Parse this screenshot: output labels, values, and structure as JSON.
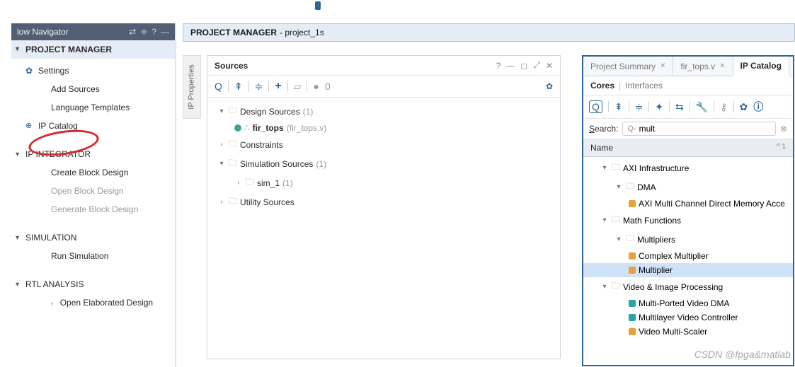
{
  "flow_nav": {
    "title": "low Navigator",
    "section0": {
      "label": "PROJECT MANAGER"
    },
    "items0": {
      "settings": "Settings",
      "add_sources": "Add Sources",
      "lang_tmpl": "Language Templates",
      "ip_catalog": "IP Catalog"
    },
    "section1": {
      "label": "IP INTEGRATOR"
    },
    "items1": {
      "create_bd": "Create Block Design",
      "open_bd": "Open Block Design",
      "gen_bd": "Generate Block Design"
    },
    "section2": {
      "label": "SIMULATION"
    },
    "items2": {
      "run_sim": "Run Simulation"
    },
    "section3": {
      "label": "RTL ANALYSIS"
    },
    "items3": {
      "open_elab": "Open Elaborated Design"
    }
  },
  "proj_header": {
    "prefix": "PROJECT MANAGER",
    "name": "- project_1s"
  },
  "ip_props_tab": "IP Properties",
  "sources": {
    "title": "Sources",
    "help": "?",
    "count": "0",
    "tree": {
      "design_sources": "Design Sources",
      "design_sources_cnt": "(1)",
      "fir_tops": "fir_tops",
      "fir_tops_file": "(fir_tops.v)",
      "constraints": "Constraints",
      "sim_sources": "Simulation Sources",
      "sim_sources_cnt": "(1)",
      "sim_1": "sim_1",
      "sim_1_cnt": "(1)",
      "utility": "Utility Sources"
    }
  },
  "right": {
    "tab_summary": "Project Summary",
    "tab_fir": "fir_tops.v",
    "tab_catalog": "IP Catalog",
    "subtab_cores": "Cores",
    "subtab_ifaces": "Interfaces",
    "search_label": "Search:",
    "search_prefix": "Q-",
    "search_value": "mult",
    "col_name": "Name",
    "tree": {
      "axi_infra": "AXI Infrastructure",
      "dma": "DMA",
      "axi_mcdma": "AXI Multi Channel Direct Memory Acce",
      "math": "Math Functions",
      "multipliers": "Multipliers",
      "complex_mult": "Complex Multiplier",
      "multiplier": "Multiplier",
      "video": "Video & Image Processing",
      "mpvdma": "Multi-Ported Video DMA",
      "mlvc": "Multilayer Video Controller",
      "scaler": "Video Multi-Scaler"
    }
  },
  "watermark": "CSDN @fpga&matlab"
}
